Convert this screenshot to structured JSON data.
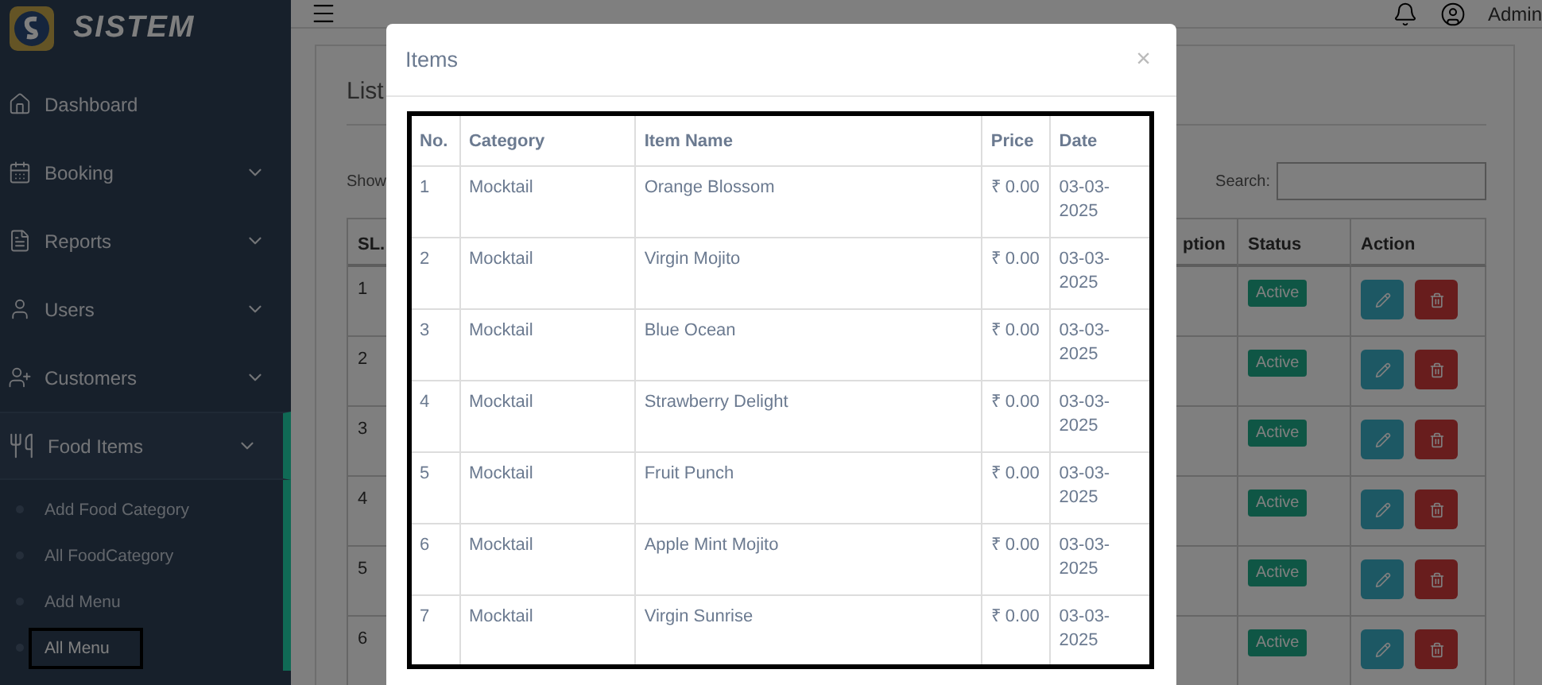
{
  "brand": "SISTEM",
  "sidebar": {
    "items": [
      {
        "label": "Dashboard",
        "kind": "link"
      },
      {
        "label": "Booking",
        "kind": "group",
        "expanded": false
      },
      {
        "label": "Reports",
        "kind": "group",
        "expanded": false
      },
      {
        "label": "Users",
        "kind": "group",
        "expanded": false
      },
      {
        "label": "Customers",
        "kind": "group",
        "expanded": false
      },
      {
        "label": "Food Items",
        "kind": "group",
        "expanded": true,
        "children": [
          {
            "label": "Add Food Category",
            "selected": false
          },
          {
            "label": "All FoodCategory",
            "selected": false
          },
          {
            "label": "Add Menu",
            "selected": false
          },
          {
            "label": "All Menu",
            "selected": true
          }
        ]
      }
    ]
  },
  "topbar": {
    "user": "Admin"
  },
  "page": {
    "title": "List",
    "show_label": "Show",
    "search_label": "Search:",
    "columns": [
      "SL.",
      "ption",
      "Status",
      "Action"
    ],
    "rows": [
      {
        "sl": "1",
        "status": "Active"
      },
      {
        "sl": "2",
        "status": "Active"
      },
      {
        "sl": "3",
        "status": "Active"
      },
      {
        "sl": "4",
        "status": "Active"
      },
      {
        "sl": "5",
        "status": "Active"
      },
      {
        "sl": "6",
        "status": "Active"
      }
    ]
  },
  "modal": {
    "title": "Items",
    "close": "×",
    "columns": [
      "No.",
      "Category",
      "Item Name",
      "Price",
      "Date"
    ],
    "rows": [
      {
        "no": "1",
        "category": "Mocktail",
        "item": "Orange Blossom",
        "price": "₹ 0.00",
        "date": "03-03-2025"
      },
      {
        "no": "2",
        "category": "Mocktail",
        "item": "Virgin Mojito",
        "price": "₹ 0.00",
        "date": "03-03-2025"
      },
      {
        "no": "3",
        "category": "Mocktail",
        "item": "Blue Ocean",
        "price": "₹ 0.00",
        "date": "03-03-2025"
      },
      {
        "no": "4",
        "category": "Mocktail",
        "item": "Strawberry Delight",
        "price": "₹ 0.00",
        "date": "03-03-2025"
      },
      {
        "no": "5",
        "category": "Mocktail",
        "item": "Fruit Punch",
        "price": "₹ 0.00",
        "date": "03-03-2025"
      },
      {
        "no": "6",
        "category": "Mocktail",
        "item": "Apple Mint Mojito",
        "price": "₹ 0.00",
        "date": "03-03-2025"
      },
      {
        "no": "7",
        "category": "Mocktail",
        "item": "Virgin Sunrise",
        "price": "₹ 0.00",
        "date": "03-03-2025"
      }
    ]
  }
}
